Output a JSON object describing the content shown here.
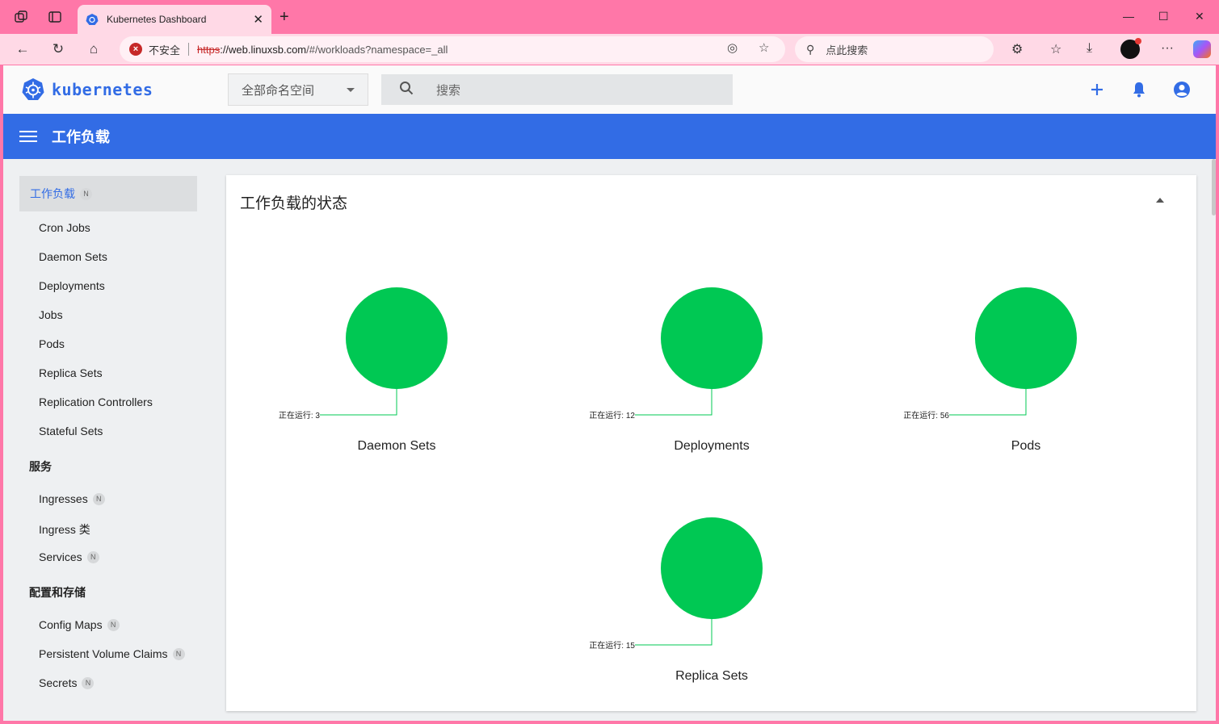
{
  "browser": {
    "tab_title": "Kubernetes Dashboard",
    "security_label": "不安全",
    "url_protocol": "https",
    "url_host": "://web.linuxsb.com",
    "url_path": "/#/workloads?namespace=_all",
    "search_placeholder": "点此搜索"
  },
  "app": {
    "logo_text": "kubernetes",
    "namespace_selected": "全部命名空间",
    "search_placeholder": "搜索",
    "toolbar_title": "工作负载"
  },
  "sidebar": {
    "active": {
      "label": "工作负载",
      "badge": "N"
    },
    "workloads": [
      {
        "label": "Cron Jobs"
      },
      {
        "label": "Daemon Sets"
      },
      {
        "label": "Deployments"
      },
      {
        "label": "Jobs"
      },
      {
        "label": "Pods"
      },
      {
        "label": "Replica Sets"
      },
      {
        "label": "Replication Controllers"
      },
      {
        "label": "Stateful Sets"
      }
    ],
    "services_header": "服务",
    "services": [
      {
        "label": "Ingresses",
        "badge": "N"
      },
      {
        "label": "Ingress 类"
      },
      {
        "label": "Services",
        "badge": "N"
      }
    ],
    "config_header": "配置和存储",
    "config": [
      {
        "label": "Config Maps",
        "badge": "N"
      },
      {
        "label": "Persistent Volume Claims",
        "badge": "N"
      },
      {
        "label": "Secrets",
        "badge": "N"
      }
    ]
  },
  "card": {
    "title": "工作负载的状态"
  },
  "colors": {
    "accent": "#326ce5",
    "running": "#00c853"
  },
  "chart_data": {
    "type": "pie",
    "charts": [
      {
        "title": "Daemon Sets",
        "slices": [
          {
            "label": "正在运行",
            "value": 3
          }
        ],
        "label_text": "正在运行: 3"
      },
      {
        "title": "Deployments",
        "slices": [
          {
            "label": "正在运行",
            "value": 12
          }
        ],
        "label_text": "正在运行: 12"
      },
      {
        "title": "Pods",
        "slices": [
          {
            "label": "正在运行",
            "value": 56
          }
        ],
        "label_text": "正在运行: 56"
      },
      {
        "title": "Replica Sets",
        "slices": [
          {
            "label": "正在运行",
            "value": 15
          }
        ],
        "label_text": "正在运行: 15"
      }
    ]
  }
}
